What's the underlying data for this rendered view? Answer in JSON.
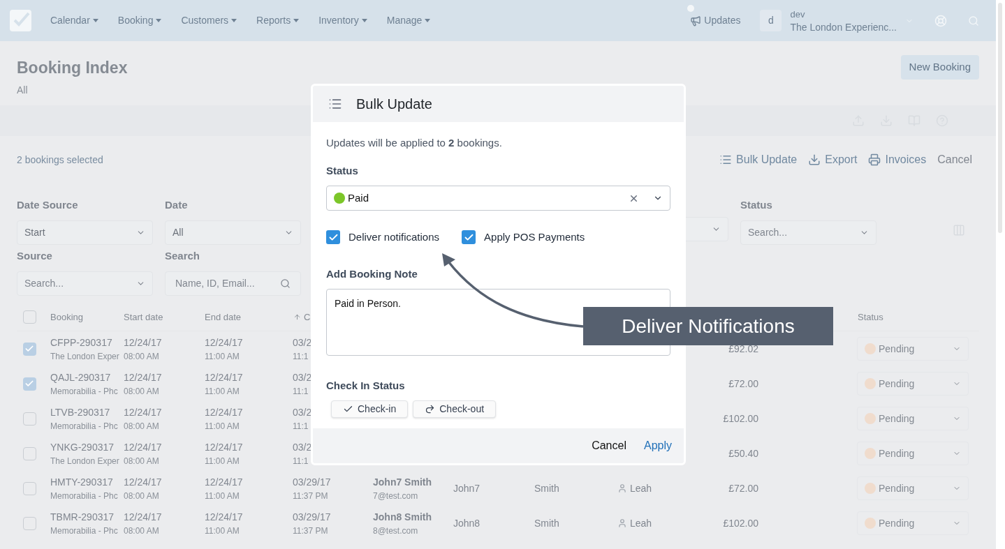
{
  "nav": {
    "menu": [
      {
        "label": "Calendar"
      },
      {
        "label": "Booking"
      },
      {
        "label": "Customers"
      },
      {
        "label": "Reports"
      },
      {
        "label": "Inventory"
      },
      {
        "label": "Manage"
      }
    ],
    "updates": {
      "label": "Updates",
      "unread": true
    },
    "user": {
      "avatar": "d",
      "name": "dev",
      "company": "The London Experienc..."
    }
  },
  "header": {
    "title": "Booking Index",
    "subtitle": "All",
    "new_button": "New Booking"
  },
  "selection_bar": {
    "count": "2 bookings selected",
    "actions": [
      {
        "kind": "bulk",
        "label": "Bulk Update"
      },
      {
        "kind": "export",
        "label": "Export"
      },
      {
        "kind": "print",
        "label": "Invoices"
      },
      {
        "kind": "plain",
        "label": "Cancel"
      }
    ]
  },
  "filters": {
    "date_source": {
      "label": "Date Source",
      "value": "Start"
    },
    "date": {
      "label": "Date",
      "value": "All"
    },
    "source": {
      "label": "Source",
      "placeholder": "Search..."
    },
    "search": {
      "label": "Search",
      "placeholder": "Name, ID, Email..."
    },
    "status": {
      "label": "Status",
      "placeholder": "Search..."
    }
  },
  "table": {
    "all_selected": false,
    "columns": [
      "Booking",
      "Start date",
      "End date",
      "C",
      "Status"
    ],
    "rows": [
      {
        "selected": true,
        "booking": "CFPP-290317",
        "booking_sub": "The London Exper",
        "start_date": "12/24/17",
        "start_time": "08:00 AM",
        "end_date": "12/24/17",
        "end_time": "11:00 AM",
        "created_date": "03/2",
        "created_time": "11:1",
        "price": "£92.02",
        "status": "Pending",
        "color": "#f0dccd"
      },
      {
        "selected": true,
        "booking": "QAJL-290317",
        "booking_sub": "Memorabilia - Phc",
        "start_date": "12/24/17",
        "start_time": "08:00 AM",
        "end_date": "12/24/17",
        "end_time": "11:00 AM",
        "created_date": "03/2",
        "created_time": "11:1",
        "price": "£72.00",
        "status": "Pending",
        "color": "#f0dccd"
      },
      {
        "selected": false,
        "booking": "LTVB-290317",
        "booking_sub": "Memorabilia - Phc",
        "start_date": "12/24/17",
        "start_time": "08:00 AM",
        "end_date": "12/24/17",
        "end_time": "11:00 AM",
        "created_date": "03/2",
        "created_time": "11:1",
        "price": "£102.00",
        "status": "Pending",
        "color": "#f0dccd"
      },
      {
        "selected": false,
        "booking": "YNKG-290317",
        "booking_sub": "The London Exper",
        "start_date": "12/24/17",
        "start_time": "08:00 AM",
        "end_date": "12/24/17",
        "end_time": "11:00 AM",
        "created_date": "03/2",
        "created_time": "11:1",
        "price": "£50.40",
        "status": "Pending",
        "color": "#f0dccd"
      },
      {
        "selected": false,
        "booking": "HMTY-290317",
        "booking_sub": "Memorabilia - Phc",
        "start_date": "12/24/17",
        "start_time": "08:00 AM",
        "end_date": "12/24/17",
        "end_time": "11:00 AM",
        "created_date": "03/29/17",
        "created_time": "11:37 PM",
        "customer": "John7 Smith",
        "email": "7@test.com",
        "first_name": "John7",
        "last_name": "Smith",
        "staff": "Leah",
        "price": "£72.00",
        "status": "Pending",
        "color": "#f0dccd"
      },
      {
        "selected": false,
        "booking": "TBMR-290317",
        "booking_sub": "Memorabilia - Phc",
        "start_date": "12/24/17",
        "start_time": "08:00 AM",
        "end_date": "12/24/17",
        "end_time": "11:00 AM",
        "created_date": "03/29/17",
        "created_time": "11:37 PM",
        "customer": "John8 Smith",
        "email": "8@test.com",
        "first_name": "John8",
        "last_name": "Smith",
        "staff": "Leah",
        "price": "£102.00",
        "status": "Pending",
        "color": "#f0dccd"
      }
    ]
  },
  "modal": {
    "title": "Bulk Update",
    "summary": "Updates will be applied to **2** bookings.",
    "status": {
      "label": "Status",
      "value": "Paid",
      "color": "#7cc629"
    },
    "options": [
      {
        "label": "Deliver notifications",
        "checked": true
      },
      {
        "label": "Apply POS Payments",
        "checked": true
      }
    ],
    "note": {
      "label": "Add Booking Note",
      "value": "Paid in Person."
    },
    "check_in": {
      "label": "Check In Status",
      "buttons": [
        {
          "kind": "check",
          "label": "Check-in"
        },
        {
          "kind": "redo",
          "label": "Check-out"
        }
      ]
    },
    "cancel": "Cancel",
    "apply": "Apply"
  },
  "callout": {
    "text": "Deliver Notifications"
  }
}
